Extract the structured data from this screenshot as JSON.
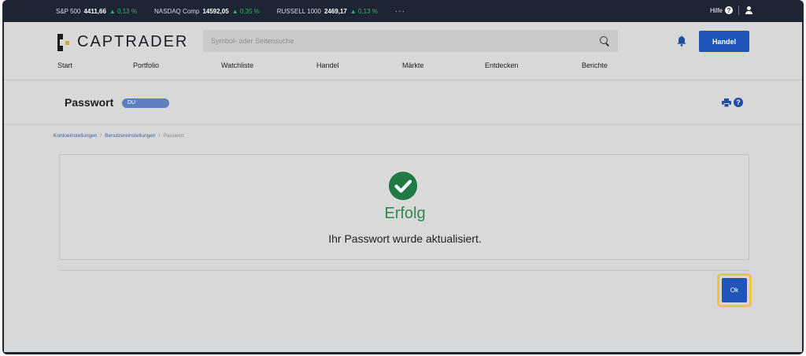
{
  "ticker": [
    {
      "name": "S&P 500",
      "value": "4411,66",
      "change": "▲ 0,13 %"
    },
    {
      "name": "NASDAQ Comp",
      "value": "14592,05",
      "change": "▲ 0,35 %"
    },
    {
      "name": "RUSSELL 1000",
      "value": "2469,17",
      "change": "▲ 0,13 %"
    }
  ],
  "ticker_more": "···",
  "help_label": "Hilfe",
  "logo_text": "CAPTRADER",
  "search": {
    "placeholder": "Symbol- oder Seitensuche"
  },
  "header_button": "Handel",
  "nav": [
    "Start",
    "Portfolio",
    "Watchliste",
    "Handel",
    "Märkte",
    "Entdecken",
    "Berichte"
  ],
  "page": {
    "title": "Passwort",
    "badge": "DU"
  },
  "breadcrumb": [
    "Kontoeinstellungen",
    "Benutzereinstellungen",
    "Passwort"
  ],
  "result": {
    "title": "Erfolg",
    "message": "Ihr Passwort wurde aktualisiert."
  },
  "ok_label": "Ok",
  "colors": {
    "accent": "#1f55b6",
    "success": "#2b8a4f",
    "ticker_up": "#2fb36a",
    "highlight": "#f3c13a"
  }
}
